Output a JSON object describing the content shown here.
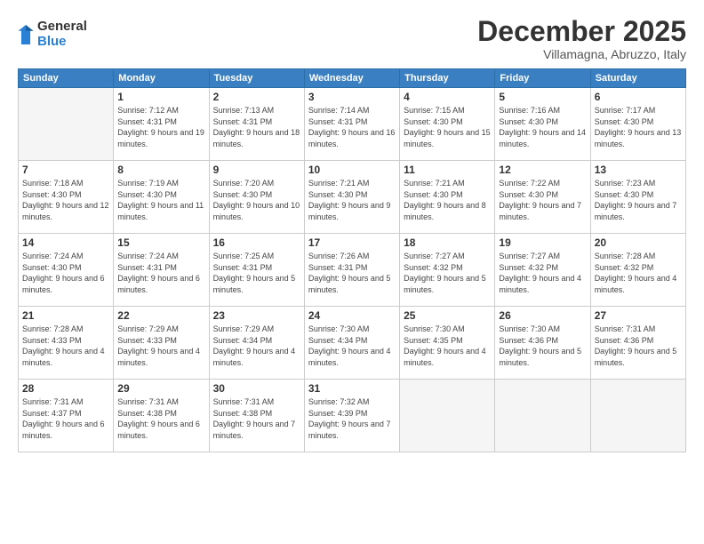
{
  "logo": {
    "general": "General",
    "blue": "Blue"
  },
  "header": {
    "month": "December 2025",
    "location": "Villamagna, Abruzzo, Italy"
  },
  "weekdays": [
    "Sunday",
    "Monday",
    "Tuesday",
    "Wednesday",
    "Thursday",
    "Friday",
    "Saturday"
  ],
  "weeks": [
    [
      {
        "day": "",
        "empty": true
      },
      {
        "day": "1",
        "rise": "7:12 AM",
        "set": "4:31 PM",
        "daylight": "9 hours and 19 minutes."
      },
      {
        "day": "2",
        "rise": "7:13 AM",
        "set": "4:31 PM",
        "daylight": "9 hours and 18 minutes."
      },
      {
        "day": "3",
        "rise": "7:14 AM",
        "set": "4:31 PM",
        "daylight": "9 hours and 16 minutes."
      },
      {
        "day": "4",
        "rise": "7:15 AM",
        "set": "4:30 PM",
        "daylight": "9 hours and 15 minutes."
      },
      {
        "day": "5",
        "rise": "7:16 AM",
        "set": "4:30 PM",
        "daylight": "9 hours and 14 minutes."
      },
      {
        "day": "6",
        "rise": "7:17 AM",
        "set": "4:30 PM",
        "daylight": "9 hours and 13 minutes."
      }
    ],
    [
      {
        "day": "7",
        "rise": "7:18 AM",
        "set": "4:30 PM",
        "daylight": "9 hours and 12 minutes."
      },
      {
        "day": "8",
        "rise": "7:19 AM",
        "set": "4:30 PM",
        "daylight": "9 hours and 11 minutes."
      },
      {
        "day": "9",
        "rise": "7:20 AM",
        "set": "4:30 PM",
        "daylight": "9 hours and 10 minutes."
      },
      {
        "day": "10",
        "rise": "7:21 AM",
        "set": "4:30 PM",
        "daylight": "9 hours and 9 minutes."
      },
      {
        "day": "11",
        "rise": "7:21 AM",
        "set": "4:30 PM",
        "daylight": "9 hours and 8 minutes."
      },
      {
        "day": "12",
        "rise": "7:22 AM",
        "set": "4:30 PM",
        "daylight": "9 hours and 7 minutes."
      },
      {
        "day": "13",
        "rise": "7:23 AM",
        "set": "4:30 PM",
        "daylight": "9 hours and 7 minutes."
      }
    ],
    [
      {
        "day": "14",
        "rise": "7:24 AM",
        "set": "4:30 PM",
        "daylight": "9 hours and 6 minutes."
      },
      {
        "day": "15",
        "rise": "7:24 AM",
        "set": "4:31 PM",
        "daylight": "9 hours and 6 minutes."
      },
      {
        "day": "16",
        "rise": "7:25 AM",
        "set": "4:31 PM",
        "daylight": "9 hours and 5 minutes."
      },
      {
        "day": "17",
        "rise": "7:26 AM",
        "set": "4:31 PM",
        "daylight": "9 hours and 5 minutes."
      },
      {
        "day": "18",
        "rise": "7:27 AM",
        "set": "4:32 PM",
        "daylight": "9 hours and 5 minutes."
      },
      {
        "day": "19",
        "rise": "7:27 AM",
        "set": "4:32 PM",
        "daylight": "9 hours and 4 minutes."
      },
      {
        "day": "20",
        "rise": "7:28 AM",
        "set": "4:32 PM",
        "daylight": "9 hours and 4 minutes."
      }
    ],
    [
      {
        "day": "21",
        "rise": "7:28 AM",
        "set": "4:33 PM",
        "daylight": "9 hours and 4 minutes."
      },
      {
        "day": "22",
        "rise": "7:29 AM",
        "set": "4:33 PM",
        "daylight": "9 hours and 4 minutes."
      },
      {
        "day": "23",
        "rise": "7:29 AM",
        "set": "4:34 PM",
        "daylight": "9 hours and 4 minutes."
      },
      {
        "day": "24",
        "rise": "7:30 AM",
        "set": "4:34 PM",
        "daylight": "9 hours and 4 minutes."
      },
      {
        "day": "25",
        "rise": "7:30 AM",
        "set": "4:35 PM",
        "daylight": "9 hours and 4 minutes."
      },
      {
        "day": "26",
        "rise": "7:30 AM",
        "set": "4:36 PM",
        "daylight": "9 hours and 5 minutes."
      },
      {
        "day": "27",
        "rise": "7:31 AM",
        "set": "4:36 PM",
        "daylight": "9 hours and 5 minutes."
      }
    ],
    [
      {
        "day": "28",
        "rise": "7:31 AM",
        "set": "4:37 PM",
        "daylight": "9 hours and 6 minutes."
      },
      {
        "day": "29",
        "rise": "7:31 AM",
        "set": "4:38 PM",
        "daylight": "9 hours and 6 minutes."
      },
      {
        "day": "30",
        "rise": "7:31 AM",
        "set": "4:38 PM",
        "daylight": "9 hours and 7 minutes."
      },
      {
        "day": "31",
        "rise": "7:32 AM",
        "set": "4:39 PM",
        "daylight": "9 hours and 7 minutes."
      },
      {
        "day": "",
        "empty": true
      },
      {
        "day": "",
        "empty": true
      },
      {
        "day": "",
        "empty": true
      }
    ]
  ]
}
